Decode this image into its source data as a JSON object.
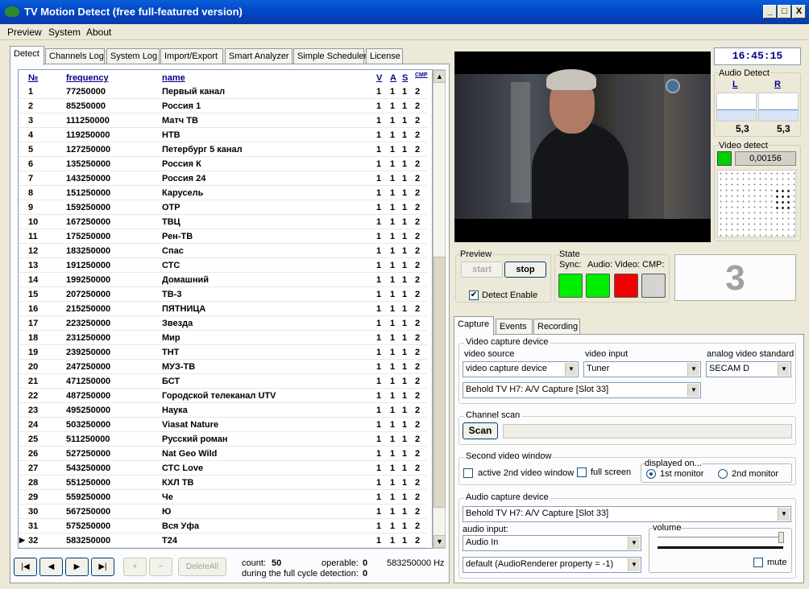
{
  "window": {
    "title": "TV Motion Detect (free full-featured version)",
    "min": "_",
    "max": "□",
    "close": "X"
  },
  "menu": [
    "Preview",
    "System",
    "About"
  ],
  "left_tabs": [
    "Detect",
    "Channels Log",
    "System Log",
    "Import/Export",
    "Smart Analyzer",
    "Simple Scheduler",
    "License"
  ],
  "grid": {
    "headers": [
      "№",
      "frequency",
      "name",
      "V",
      "A",
      "S",
      "CMP"
    ],
    "rows": [
      [
        "1",
        "77250000",
        "Первый канал",
        "1",
        "1",
        "1",
        "2"
      ],
      [
        "2",
        "85250000",
        "Россия 1",
        "1",
        "1",
        "1",
        "2"
      ],
      [
        "3",
        "111250000",
        "Матч ТВ",
        "1",
        "1",
        "1",
        "2"
      ],
      [
        "4",
        "119250000",
        "НТВ",
        "1",
        "1",
        "1",
        "2"
      ],
      [
        "5",
        "127250000",
        "Петербург 5 канал",
        "1",
        "1",
        "1",
        "2"
      ],
      [
        "6",
        "135250000",
        "Россия К",
        "1",
        "1",
        "1",
        "2"
      ],
      [
        "7",
        "143250000",
        "Россия 24",
        "1",
        "1",
        "1",
        "2"
      ],
      [
        "8",
        "151250000",
        "Карусель",
        "1",
        "1",
        "1",
        "2"
      ],
      [
        "9",
        "159250000",
        "ОТР",
        "1",
        "1",
        "1",
        "2"
      ],
      [
        "10",
        "167250000",
        "ТВЦ",
        "1",
        "1",
        "1",
        "2"
      ],
      [
        "11",
        "175250000",
        "Рен-ТВ",
        "1",
        "1",
        "1",
        "2"
      ],
      [
        "12",
        "183250000",
        "Спас",
        "1",
        "1",
        "1",
        "2"
      ],
      [
        "13",
        "191250000",
        "СТС",
        "1",
        "1",
        "1",
        "2"
      ],
      [
        "14",
        "199250000",
        "Домашний",
        "1",
        "1",
        "1",
        "2"
      ],
      [
        "15",
        "207250000",
        "ТВ-3",
        "1",
        "1",
        "1",
        "2"
      ],
      [
        "16",
        "215250000",
        "ПЯТНИЦА",
        "1",
        "1",
        "1",
        "2"
      ],
      [
        "17",
        "223250000",
        "Звезда",
        "1",
        "1",
        "1",
        "2"
      ],
      [
        "18",
        "231250000",
        "Мир",
        "1",
        "1",
        "1",
        "2"
      ],
      [
        "19",
        "239250000",
        "ТНТ",
        "1",
        "1",
        "1",
        "2"
      ],
      [
        "20",
        "247250000",
        "МУЗ-ТВ",
        "1",
        "1",
        "1",
        "2"
      ],
      [
        "21",
        "471250000",
        "БСТ",
        "1",
        "1",
        "1",
        "2"
      ],
      [
        "22",
        "487250000",
        "Городской телеканал UTV",
        "1",
        "1",
        "1",
        "2"
      ],
      [
        "23",
        "495250000",
        "Наука",
        "1",
        "1",
        "1",
        "2"
      ],
      [
        "24",
        "503250000",
        "Viasat Nature",
        "1",
        "1",
        "1",
        "2"
      ],
      [
        "25",
        "511250000",
        "Русский роман",
        "1",
        "1",
        "1",
        "2"
      ],
      [
        "26",
        "527250000",
        "Nat Geo Wild",
        "1",
        "1",
        "1",
        "2"
      ],
      [
        "27",
        "543250000",
        "СТС Love",
        "1",
        "1",
        "1",
        "2"
      ],
      [
        "28",
        "551250000",
        "КХЛ ТВ",
        "1",
        "1",
        "1",
        "2"
      ],
      [
        "29",
        "559250000",
        "Че",
        "1",
        "1",
        "1",
        "2"
      ],
      [
        "30",
        "567250000",
        "Ю",
        "1",
        "1",
        "1",
        "2"
      ],
      [
        "31",
        "575250000",
        "Вся Уфа",
        "1",
        "1",
        "1",
        "2"
      ],
      [
        "32",
        "583250000",
        "Т24",
        "1",
        "1",
        "1",
        "2"
      ]
    ],
    "current_row_marker": "▶"
  },
  "nav": {
    "first": "|◀",
    "prev": "◀",
    "next": "▶",
    "last": "▶|",
    "add": "+",
    "remove": "−",
    "delete_all": "DeleteAll"
  },
  "status": {
    "count_label": "count:",
    "count": "50",
    "operable_label": "operable:",
    "operable": "0",
    "cycle_label": "during the full cycle detection:",
    "cycle": "0",
    "freq": "583250000 Hz"
  },
  "clock": "16:45:15",
  "audio": {
    "title": "Audio Detect",
    "l": "L",
    "r": "R",
    "l_val": "5,3",
    "r_val": "5,3",
    "l_level": 0.4,
    "r_level": 0.4
  },
  "video": {
    "title": "Video detect",
    "value": "0,00156"
  },
  "preview": {
    "title": "Preview",
    "start": "start",
    "stop": "stop",
    "detect_enable": "Detect Enable",
    "detect_checked": "✔"
  },
  "state": {
    "title": "State",
    "sync": "Sync:",
    "audio": "Audio:",
    "video": "Video:",
    "cmp": "CMP:",
    "colors": [
      "#00ee00",
      "#00ee00",
      "#ee0000",
      "#d4d4d4"
    ]
  },
  "big_number": "3",
  "right_tabs": [
    "Capture",
    "Events",
    "Recording"
  ],
  "capture": {
    "group_video": "Video capture device",
    "video_source_label": "video source",
    "video_source": "video capture device",
    "video_input_label": "video input",
    "video_input": "Tuner",
    "standard_label": "analog video standard",
    "standard": "SECAM D",
    "device": "Behold TV H7: A/V Capture [Slot 33]",
    "group_scan": "Channel scan",
    "scan": "Scan",
    "group_second": "Second video window",
    "active2": "active 2nd video window",
    "fullscreen": "full screen",
    "displayed_on": "displayed on...",
    "mon1": "1st monitor",
    "mon2": "2nd monitor",
    "group_audio": "Audio capture device",
    "audio_device": "Behold TV H7: A/V Capture [Slot 33]",
    "audio_input_label": "audio input:",
    "audio_input": "Audio In",
    "renderer": "default (AudioRenderer property = -1)",
    "volume": "volume",
    "mute": "mute"
  }
}
